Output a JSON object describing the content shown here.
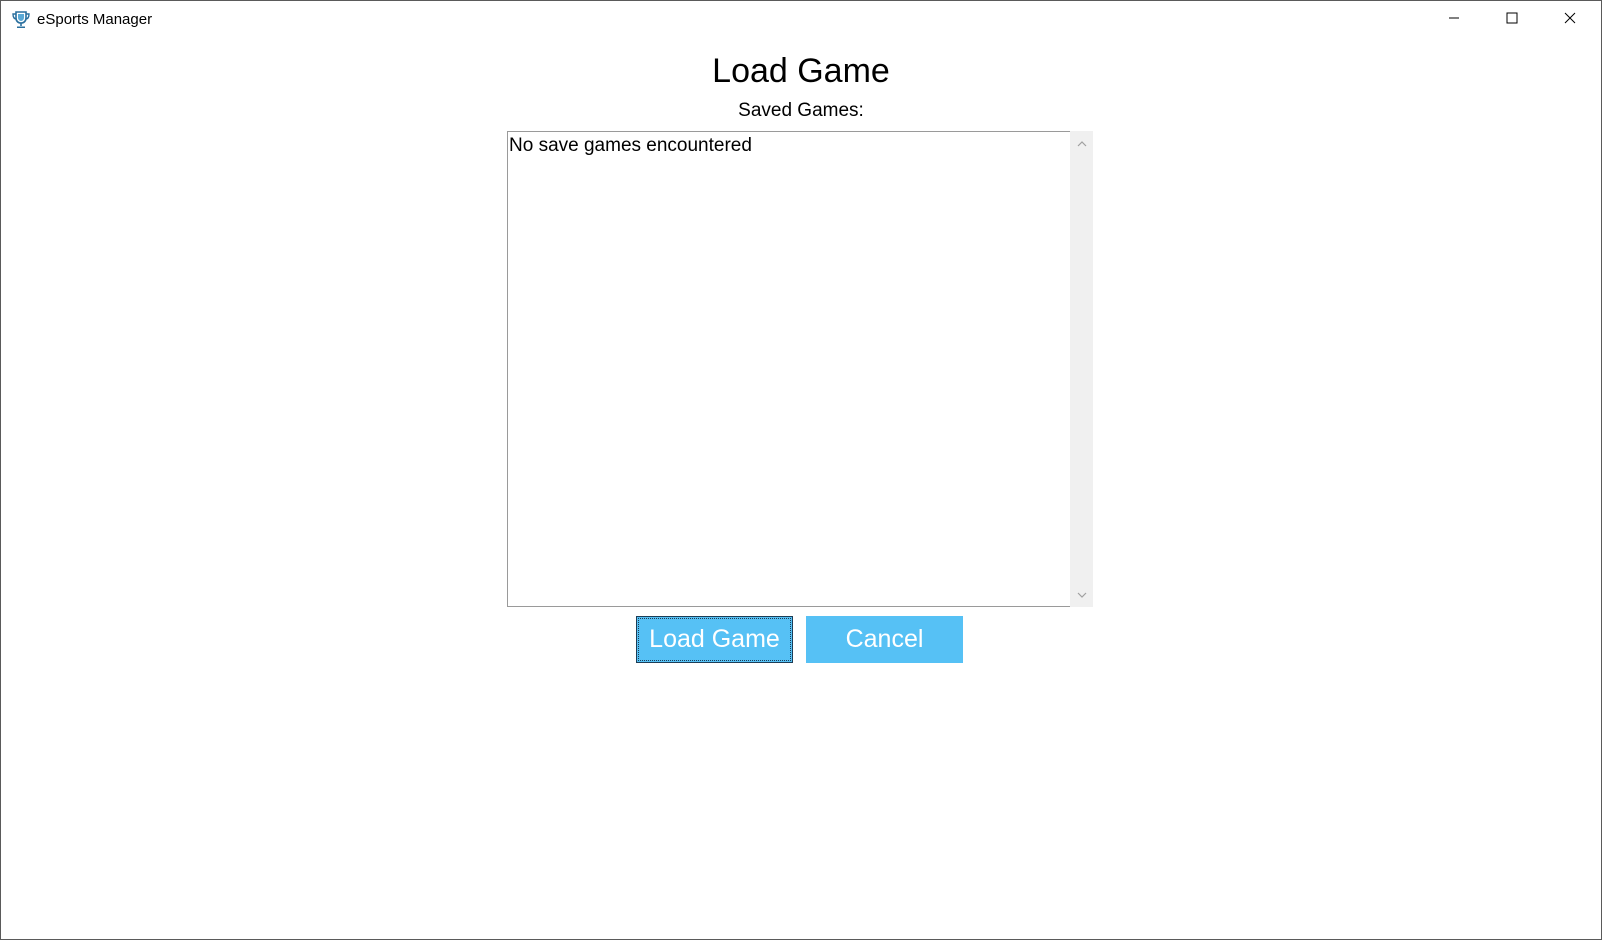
{
  "window": {
    "title": "eSports Manager",
    "app_icon": "trophy-icon",
    "controls": [
      "minimize-icon",
      "maximize-icon",
      "close-icon"
    ]
  },
  "main": {
    "heading": "Load Game",
    "saved_games_label": "Saved Games:",
    "saved_games": [
      "No save games encountered"
    ]
  },
  "buttons": {
    "load_label": "Load Game",
    "cancel_label": "Cancel"
  },
  "colors": {
    "button_bg": "#56c1f5",
    "button_text": "#ffffff",
    "scrollbar_bg": "#f0f0f0"
  }
}
